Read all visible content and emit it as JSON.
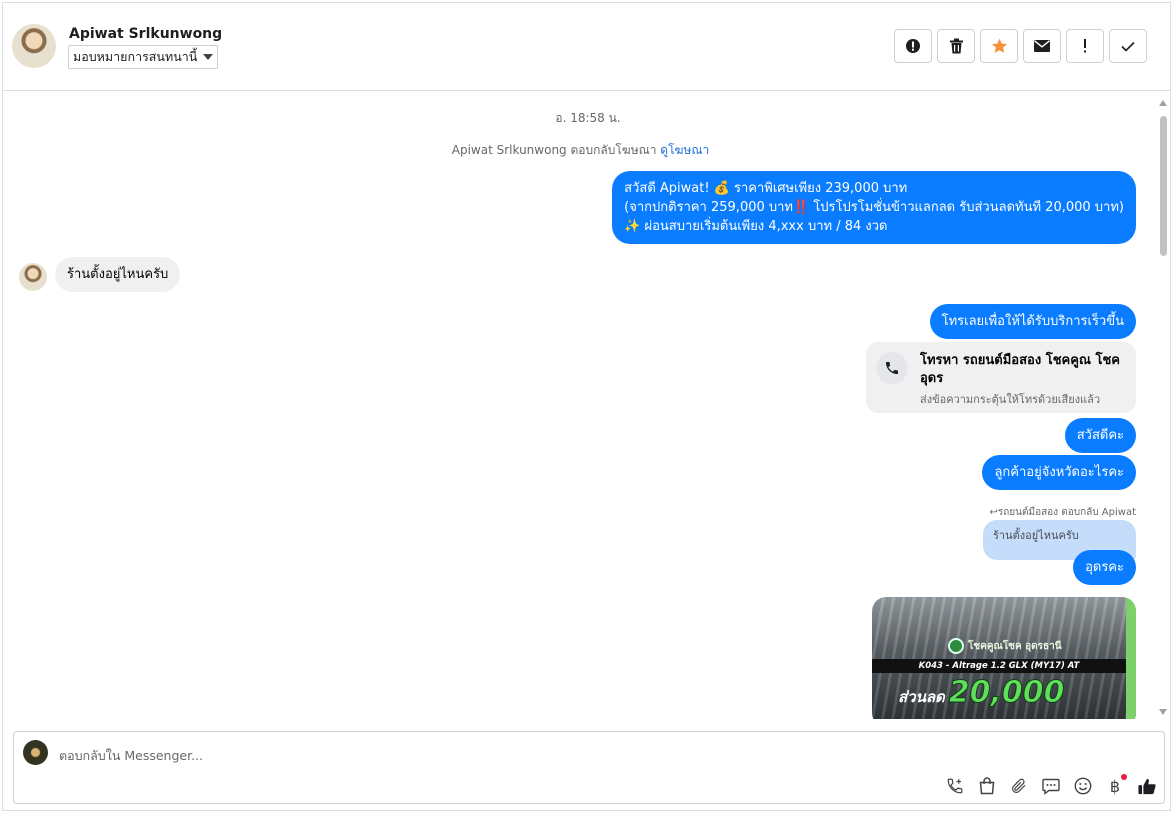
{
  "header": {
    "contact_name": "Apiwat Srlkunwong",
    "assign_label": "มอบหมายการสนทนานี้",
    "actions": [
      {
        "icon": "alert-circle-icon"
      },
      {
        "icon": "trash-icon"
      },
      {
        "icon": "star-icon"
      },
      {
        "icon": "envelope-icon"
      },
      {
        "icon": "exclamation-icon"
      },
      {
        "icon": "check-icon"
      }
    ]
  },
  "thread": {
    "timestamp": "อ. 18:58 น.",
    "reply_note": "Apiwat Srlkunwong ตอบกลับโฆษณา",
    "reply_note_link": "ดูโฆษณา",
    "messages": {
      "m1_line1": "สวัสดี Apiwat! 💰 ราคาพิเศษเพียง 239,000 บาท",
      "m1_line2": "(จากปกติราคา 259,000 บาท‼️ โปรโปรโมชั่นข้าวแลกลด รับส่วนลดทันที 20,000 บาท)",
      "m1_line3": "✨ ผ่อนสบายเริ่มต้นเพียง 4,xxx บาท / 84 งวด",
      "m2": "ร้านตั้งอยู่ไหนครับ",
      "m3": "โทรเลยเพื่อให้ได้รับบริการเร็วขึ้น",
      "call_title": "โทรหา รถยนต์มือสอง โชคคูณ โชค อุดร",
      "call_sub": "ส่งข้อความกระตุ้นให้โทรด้วยเสียงแล้ว",
      "m4": "สวัสดีคะ",
      "m5": "ลูกค้าอยู่จังหวัดอะไรคะ",
      "quote_label": "รถยนต์มือสอง ตอบกลับ Apiwat",
      "quote_text": "ร้านตั้งอยู่ไหนครับ",
      "m6": "อุดรคะ"
    },
    "image": {
      "logo_text": "โชคคูณโชค อุดรธานี",
      "model": "K043 - Altrage 1.2 GLX (MY17) AT",
      "discount_label": "ส่วนลด",
      "discount_amount": "20,000"
    }
  },
  "composer": {
    "placeholder": "ตอบกลับใน Messenger...",
    "tools": [
      "phone-plus-icon",
      "shopping-bag-icon",
      "paperclip-icon",
      "chat-bubble-icon",
      "smiley-icon",
      "baht-icon",
      "thumbs-up-icon"
    ]
  },
  "colors": {
    "accent": "#0a7cff",
    "incoming_bubble": "#f0f0f0",
    "star": "#f7923b",
    "quote_bubble": "#c6dcfb"
  }
}
